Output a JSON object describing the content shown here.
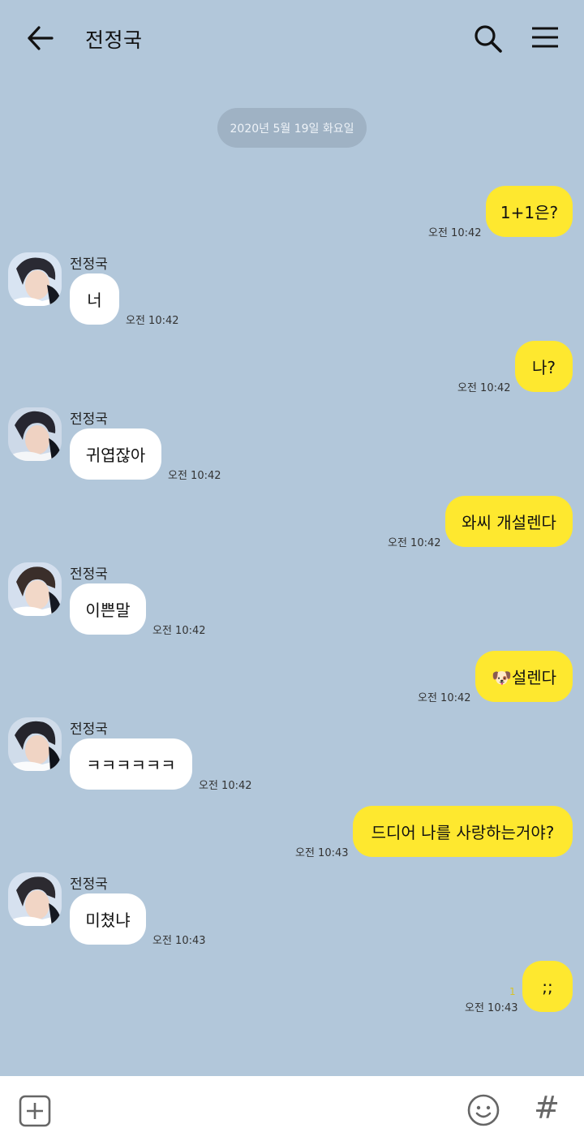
{
  "header": {
    "title": "전정국",
    "back_icon": "arrow-left-icon",
    "search_icon": "search-icon",
    "menu_icon": "hamburger-menu-icon"
  },
  "date_divider": "2020년 5월 19일 화요일",
  "messages": [
    {
      "from": "me",
      "text": "1+1은?",
      "time": "오전 10:42"
    },
    {
      "from": "them",
      "sender": "전정국",
      "text": "너",
      "time": "오전 10:42"
    },
    {
      "from": "me",
      "text": "나?",
      "time": "오전 10:42"
    },
    {
      "from": "them",
      "sender": "전정국",
      "text": "귀엽잖아",
      "time": "오전 10:42"
    },
    {
      "from": "me",
      "text": "와씨 개설렌다",
      "time": "오전 10:42"
    },
    {
      "from": "them",
      "sender": "전정국",
      "text": "이쁜말",
      "time": "오전 10:42"
    },
    {
      "from": "me",
      "text": "🐶설렌다",
      "time": "오전 10:42"
    },
    {
      "from": "them",
      "sender": "전정국",
      "text": "ㅋㅋㅋㅋㅋㅋ",
      "time": "오전 10:42"
    },
    {
      "from": "me",
      "text": "드디어 나를 사랑하는거야?",
      "time": "오전 10:43"
    },
    {
      "from": "them",
      "sender": "전정국",
      "text": "미쳤냐",
      "time": "오전 10:43"
    },
    {
      "from": "me",
      "text": ";;",
      "time": "오전 10:43",
      "unread": "1"
    }
  ],
  "bottom_bar": {
    "add_icon": "plus-square-icon",
    "emoji_icon": "smiley-icon",
    "hash_label": "#"
  },
  "colors": {
    "background": "#b2c7da",
    "my_bubble": "#fee82f",
    "their_bubble": "#ffffff",
    "date_pill": "#9fb2c4"
  }
}
